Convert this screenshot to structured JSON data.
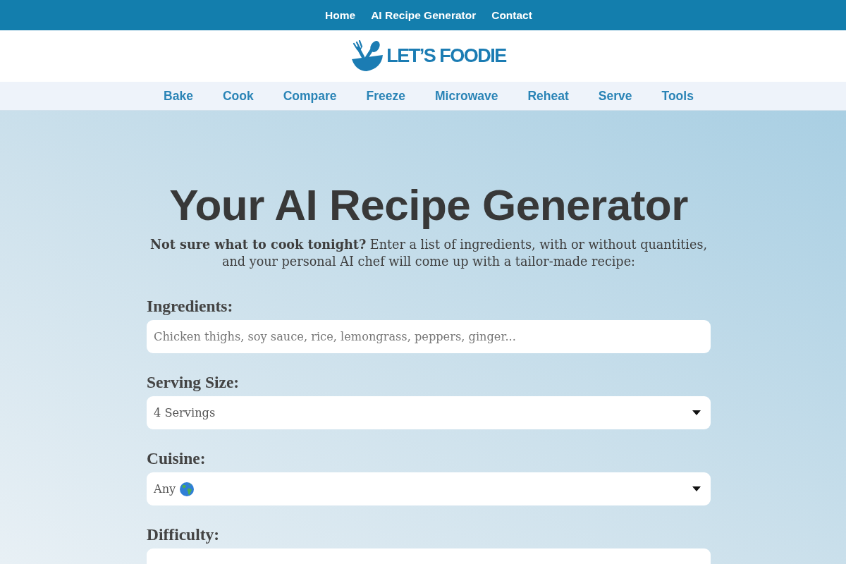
{
  "top_nav": {
    "links": [
      "Home",
      "AI Recipe Generator",
      "Contact"
    ]
  },
  "logo": {
    "text": "LET’S FOODIE"
  },
  "category_nav": {
    "links": [
      "Bake",
      "Cook",
      "Compare",
      "Freeze",
      "Microwave",
      "Reheat",
      "Serve",
      "Tools"
    ]
  },
  "hero": {
    "title": "Your AI Recipe Generator",
    "intro": "**Not sure what to cook tonight?** Enter a list of ingredients, with or without quantities,\nand your personal AI chef will come up with a tailor-made recipe:"
  },
  "form": {
    "fields": [
      {
        "label": "Ingredients:",
        "kind": "text",
        "placeholder": "Chicken thighs, soy sauce, rice, lemongrass, peppers, ginger..."
      },
      {
        "label": "Serving Size:",
        "kind": "select",
        "value": "4 Servings",
        "icon": false,
        "caret": true
      },
      {
        "label": "Cuisine:",
        "kind": "select",
        "value": "Any",
        "icon": true,
        "caret": true
      },
      {
        "label": "Difficulty:",
        "kind": "select",
        "icon": false,
        "caret": false
      }
    ]
  }
}
